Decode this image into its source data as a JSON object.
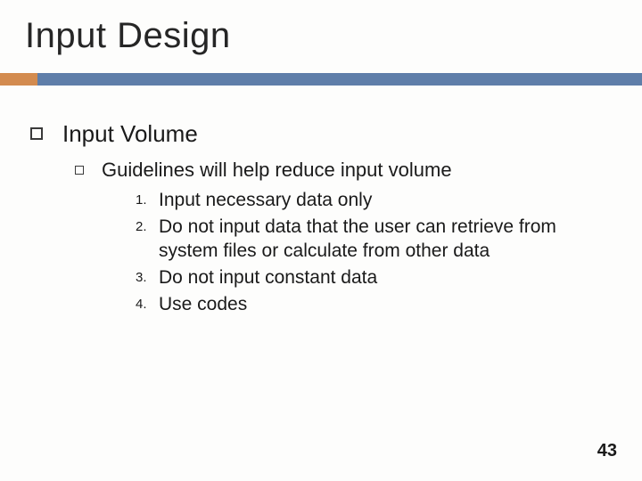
{
  "slide": {
    "title": "Input Design",
    "page_number": "43",
    "colors": {
      "bar_main": "#5f7ea9",
      "bar_accent": "#d38b4f"
    },
    "level1": {
      "text": "Input Volume"
    },
    "level2": {
      "text": "Guidelines will help reduce input volume"
    },
    "numbered": [
      {
        "n": "1.",
        "text": "Input necessary data only"
      },
      {
        "n": "2.",
        "text": "Do not input data that the user can retrieve from system files or calculate from other data"
      },
      {
        "n": "3.",
        "text": "Do not input constant data"
      },
      {
        "n": "4.",
        "text": "Use codes"
      }
    ]
  }
}
